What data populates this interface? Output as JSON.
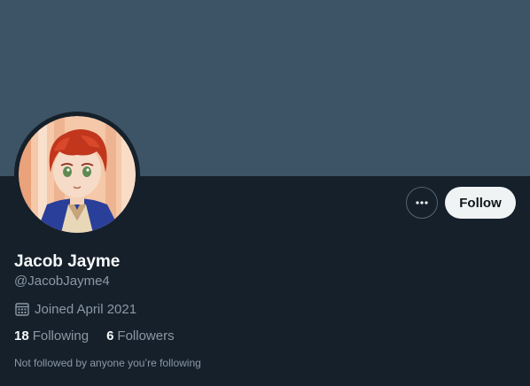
{
  "profile": {
    "name": "Jacob Jayme",
    "handle": "@JacobJayme4",
    "joined": "Joined April 2021"
  },
  "actions": {
    "follow_label": "Follow",
    "more_icon": "more-horizontal-icon"
  },
  "stats": {
    "following_count": "18",
    "following_label": "Following",
    "followers_count": "6",
    "followers_label": "Followers"
  },
  "followed_note": "Not followed by anyone you’re following",
  "colors": {
    "background": "#15202b",
    "banner": "#3d5466",
    "primary_text": "#f7f9f9",
    "secondary_text": "#8b98a5",
    "follow_button_bg": "#eff3f4"
  }
}
